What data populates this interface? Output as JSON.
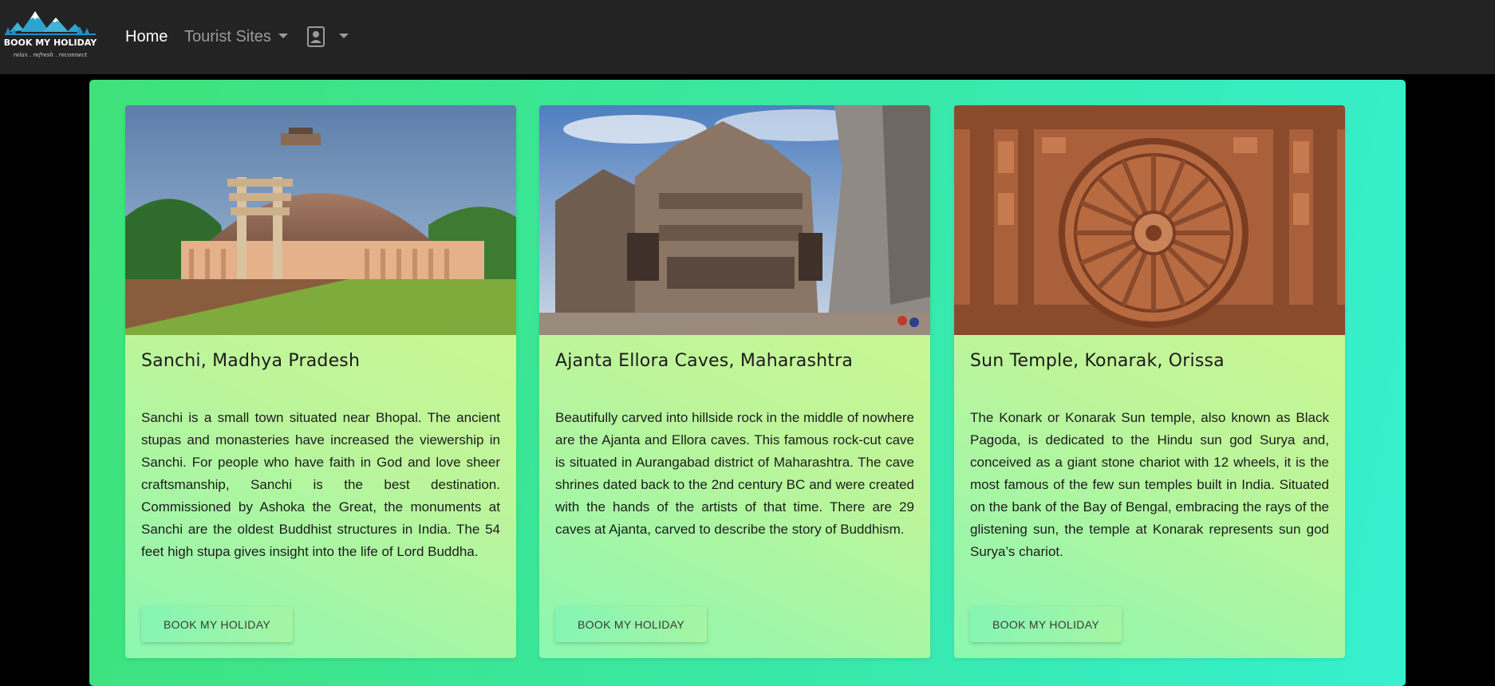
{
  "navbar": {
    "logo_text": "BOOK MY HOLIDAY",
    "logo_tagline": "relax . refresh . reconnect",
    "home_label": "Home",
    "tourist_sites_label": "Tourist Sites",
    "user_icon": "user-contact-icon"
  },
  "colors": {
    "navbar_bg": "#232323",
    "panel_gradient_start": "#3fe27a",
    "panel_gradient_end": "#36f0cf",
    "card_gradient_start": "#8cf7b1",
    "card_gradient_end": "#d8f78d"
  },
  "cards": [
    {
      "image_alt": "Sanchi stupa",
      "title": "Sanchi, Madhya Pradesh",
      "text": "Sanchi is a small town situated near Bhopal. The ancient stupas and monasteries have increased the viewership in Sanchi. For people who have faith in God and love sheer craftsmanship, Sanchi is the best destination. Commissioned by Ashoka the Great, the monuments at Sanchi are the oldest Buddhist structures in India. The 54 feet high stupa gives insight into the life of Lord Buddha.",
      "button_label": "BOOK MY HOLIDAY"
    },
    {
      "image_alt": "Ellora caves",
      "title": "Ajanta Ellora Caves, Maharashtra",
      "text": "Beautifully carved into hillside rock in the middle of nowhere are the Ajanta and Ellora caves. This famous rock-cut cave is situated in Aurangabad district of Maharashtra. The cave shrines dated back to the 2nd century BC and were created with the hands of the artists of that time. There are 29 caves at Ajanta, carved to describe the story of Buddhism.",
      "button_label": "BOOK MY HOLIDAY"
    },
    {
      "image_alt": "Konark wheel",
      "title": "Sun Temple, Konarak, Orissa",
      "text": "The Konark or Konarak Sun temple, also known as Black Pagoda, is dedicated to the Hindu sun god Surya and, conceived as a giant stone chariot with 12 wheels, it is the most famous of the few sun temples built in India. Situated on the bank of the Bay of Bengal, embracing the rays of the glistening sun, the temple at Konarak represents sun god Surya’s chariot.",
      "button_label": "BOOK MY HOLIDAY"
    }
  ]
}
